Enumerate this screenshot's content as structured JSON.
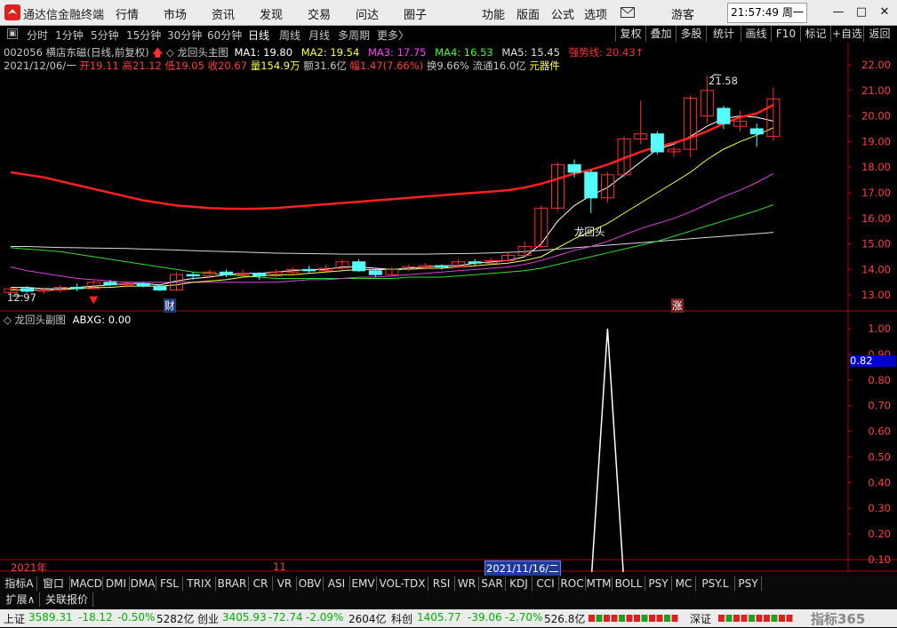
{
  "app": {
    "title": "通达信金融终端",
    "user": "游客",
    "clock": "21:57:49 周一"
  },
  "menu": [
    "行情",
    "市场",
    "资讯",
    "发现",
    "交易",
    "问达",
    "圈子"
  ],
  "menu_right": [
    "功能",
    "版面",
    "公式",
    "选项"
  ],
  "periods": [
    "分时",
    "1分钟",
    "5分钟",
    "15分钟",
    "30分钟",
    "60分钟",
    "日线",
    "周线",
    "月线",
    "多周期",
    "更多〉"
  ],
  "active_period": "日线",
  "right_buttons": [
    "复权",
    "叠加",
    "多股",
    "统计",
    "画线",
    "F10",
    "标记",
    "+自选",
    "返回"
  ],
  "stock": {
    "header": "002056 横店东磁(日线,前复权)",
    "indicator": "龙回头主图"
  },
  "ma_labels": [
    {
      "text": "MA1: 19.80",
      "color": "#ffffff"
    },
    {
      "text": "MA2: 19.54",
      "color": "#ffff40"
    },
    {
      "text": "MA3: 17.75",
      "color": "#ff40ff"
    },
    {
      "text": "MA4: 16.53",
      "color": "#40ff40"
    },
    {
      "text": "MA5: 15.45",
      "color": "#e0e0e0"
    },
    {
      "text": "强势线: 20.43",
      "color": "#ff3030"
    }
  ],
  "quote": {
    "date": "2021/12/06/一",
    "open": "开19.11",
    "high": "高21.12",
    "low": "低19.05",
    "close": "收20.67",
    "vol": "量154.9万",
    "amount": "额31.6亿",
    "change": "幅1.47(7.66%)",
    "turnover": "换9.66%",
    "float": "流通16.0亿",
    "sector": "元器件"
  },
  "annotations": {
    "high_label": "21.58",
    "low_label": "12.97",
    "signal_label": "龙回头",
    "cai_mark": "财",
    "zhang_mark": "涨"
  },
  "sub_indicator": {
    "title": "龙回头副图",
    "value_label": "ABXG: 0.00",
    "marker": "0.82"
  },
  "x_axis": {
    "year": "2021年",
    "month": "11",
    "cursor": "2021/11/16/二"
  },
  "indicator_tabs": [
    "指标A",
    "窗口",
    "MACD",
    "DMI",
    "DMA",
    "FSL",
    "TRIX",
    "BRAR",
    "CR",
    "VR",
    "OBV",
    "ASI",
    "EMV",
    "VOL-TDX",
    "RSI",
    "WR",
    "SAR",
    "KDJ",
    "CCI",
    "ROC",
    "MTM",
    "BOLL",
    "PSY",
    "MC",
    "PSY.L",
    "PSY"
  ],
  "ext_tabs": [
    "扩展∧",
    "关联报价"
  ],
  "status": {
    "sh_label": "上证",
    "sh_val": "3589.31",
    "sh_chg": "-18.12",
    "sh_pct": "-0.50%",
    "sh_amt": "5282亿",
    "cy_label": "创业",
    "cy_val": "3405.93",
    "cy_chg": "-72.74",
    "cy_pct": "-2.09%",
    "cy_amt": "2604亿",
    "kc_label": "科创",
    "kc_val": "1405.77",
    "kc_chg": "-39.06",
    "kc_pct": "-2.70%",
    "kc_amt": "526.8亿",
    "sz_label": "深证",
    "watermark": "指标365"
  },
  "chart_data": {
    "type": "candlestick",
    "main_yticks": [
      22.0,
      21.0,
      20.0,
      19.0,
      18.0,
      17.0,
      16.0,
      15.0,
      14.0,
      13.0
    ],
    "sub_yticks": [
      1.0,
      0.9,
      0.8,
      0.7,
      0.6,
      0.5,
      0.4,
      0.3,
      0.2,
      0.1
    ],
    "candles": [
      [
        13.1,
        13.25,
        13.0,
        13.3
      ],
      [
        13.25,
        13.15,
        13.1,
        13.35
      ],
      [
        13.15,
        13.2,
        13.05,
        13.3
      ],
      [
        13.2,
        13.3,
        13.1,
        13.4
      ],
      [
        13.3,
        13.25,
        13.15,
        13.45
      ],
      [
        13.25,
        13.5,
        13.2,
        13.6
      ],
      [
        13.5,
        13.4,
        13.35,
        13.6
      ],
      [
        13.4,
        13.45,
        13.3,
        13.55
      ],
      [
        13.45,
        13.35,
        13.3,
        13.5
      ],
      [
        13.35,
        13.2,
        13.15,
        13.4
      ],
      [
        13.2,
        13.8,
        13.15,
        13.9
      ],
      [
        13.8,
        13.75,
        13.6,
        13.9
      ],
      [
        13.75,
        13.9,
        13.7,
        14.0
      ],
      [
        13.9,
        13.8,
        13.7,
        14.0
      ],
      [
        13.8,
        13.85,
        13.7,
        14.0
      ],
      [
        13.85,
        13.75,
        13.6,
        13.9
      ],
      [
        13.75,
        13.9,
        13.7,
        14.0
      ],
      [
        13.9,
        14.0,
        13.8,
        14.1
      ],
      [
        14.0,
        13.95,
        13.85,
        14.15
      ],
      [
        13.95,
        14.05,
        13.9,
        14.2
      ],
      [
        14.05,
        14.3,
        14.0,
        14.4
      ],
      [
        14.3,
        13.95,
        13.9,
        14.4
      ],
      [
        13.95,
        13.8,
        13.7,
        14.0
      ],
      [
        13.8,
        14.0,
        13.75,
        14.1
      ],
      [
        14.0,
        14.1,
        13.95,
        14.2
      ],
      [
        14.1,
        14.15,
        14.0,
        14.25
      ],
      [
        14.15,
        14.1,
        14.0,
        14.2
      ],
      [
        14.1,
        14.3,
        14.05,
        14.4
      ],
      [
        14.3,
        14.25,
        14.15,
        14.4
      ],
      [
        14.25,
        14.35,
        14.2,
        14.45
      ],
      [
        14.35,
        14.55,
        14.3,
        14.7
      ],
      [
        14.55,
        14.9,
        14.5,
        15.1
      ],
      [
        14.9,
        16.4,
        14.85,
        16.5
      ],
      [
        16.4,
        18.1,
        16.3,
        18.2
      ],
      [
        18.1,
        17.8,
        17.6,
        18.3
      ],
      [
        17.8,
        16.8,
        16.2,
        17.9
      ],
      [
        16.8,
        17.7,
        16.6,
        17.8
      ],
      [
        17.7,
        19.1,
        17.6,
        19.2
      ],
      [
        19.1,
        19.3,
        18.9,
        20.6
      ],
      [
        19.3,
        18.6,
        18.5,
        19.4
      ],
      [
        18.6,
        18.7,
        18.4,
        18.8
      ],
      [
        18.7,
        20.7,
        18.4,
        20.8
      ],
      [
        20.0,
        21.0,
        19.7,
        21.58
      ],
      [
        20.3,
        19.7,
        19.5,
        20.4
      ],
      [
        19.6,
        19.8,
        19.4,
        20.2
      ],
      [
        19.5,
        19.3,
        18.8,
        19.7
      ],
      [
        19.2,
        20.67,
        19.05,
        21.12
      ]
    ],
    "strong_line": [
      17.8,
      17.7,
      17.6,
      17.45,
      17.3,
      17.15,
      17.0,
      16.85,
      16.7,
      16.6,
      16.5,
      16.45,
      16.4,
      16.38,
      16.37,
      16.38,
      16.4,
      16.45,
      16.5,
      16.55,
      16.6,
      16.65,
      16.7,
      16.75,
      16.8,
      16.85,
      16.9,
      16.95,
      17.0,
      17.05,
      17.1,
      17.2,
      17.35,
      17.55,
      17.75,
      17.9,
      18.1,
      18.35,
      18.6,
      18.8,
      18.95,
      19.15,
      19.4,
      19.7,
      19.95,
      20.1,
      20.43
    ],
    "ma1": [
      13.3,
      13.3,
      13.25,
      13.25,
      13.3,
      13.35,
      13.4,
      13.45,
      13.45,
      13.4,
      13.55,
      13.65,
      13.7,
      13.8,
      13.85,
      13.85,
      13.9,
      13.95,
      14.0,
      14.0,
      14.1,
      14.1,
      14.05,
      14.0,
      14.05,
      14.1,
      14.15,
      14.15,
      14.25,
      14.3,
      14.35,
      14.5,
      15.0,
      15.9,
      16.5,
      16.9,
      17.2,
      17.7,
      18.2,
      18.7,
      18.9,
      19.2,
      19.6,
      19.9,
      20.0,
      19.95,
      19.8
    ],
    "ma2": [
      13.2,
      13.2,
      13.2,
      13.2,
      13.25,
      13.3,
      13.3,
      13.35,
      13.35,
      13.35,
      13.4,
      13.5,
      13.55,
      13.6,
      13.7,
      13.75,
      13.8,
      13.8,
      13.85,
      13.9,
      13.95,
      14.0,
      14.0,
      14.0,
      14.0,
      14.05,
      14.05,
      14.1,
      14.15,
      14.2,
      14.25,
      14.35,
      14.5,
      14.85,
      15.2,
      15.5,
      15.8,
      16.2,
      16.6,
      17.0,
      17.4,
      17.8,
      18.3,
      18.7,
      19.0,
      19.25,
      19.54
    ],
    "ma3": [
      14.1,
      13.95,
      13.85,
      13.75,
      13.65,
      13.6,
      13.55,
      13.5,
      13.5,
      13.5,
      13.5,
      13.5,
      13.5,
      13.5,
      13.5,
      13.5,
      13.5,
      13.55,
      13.6,
      13.6,
      13.65,
      13.7,
      13.7,
      13.75,
      13.8,
      13.85,
      13.9,
      13.95,
      14.0,
      14.05,
      14.1,
      14.2,
      14.35,
      14.55,
      14.75,
      14.9,
      15.1,
      15.35,
      15.6,
      15.8,
      16.0,
      16.25,
      16.55,
      16.85,
      17.1,
      17.4,
      17.75
    ],
    "ma4": [
      14.85,
      14.8,
      14.75,
      14.7,
      14.6,
      14.5,
      14.4,
      14.3,
      14.2,
      14.1,
      14.0,
      13.9,
      13.85,
      13.8,
      13.75,
      13.7,
      13.65,
      13.65,
      13.65,
      13.65,
      13.65,
      13.65,
      13.65,
      13.65,
      13.7,
      13.7,
      13.7,
      13.75,
      13.8,
      13.85,
      13.9,
      13.95,
      14.05,
      14.2,
      14.35,
      14.5,
      14.65,
      14.8,
      14.95,
      15.1,
      15.3,
      15.5,
      15.7,
      15.9,
      16.1,
      16.3,
      16.53
    ],
    "ma5": [
      14.9,
      14.9,
      14.88,
      14.86,
      14.85,
      14.84,
      14.83,
      14.82,
      14.8,
      14.78,
      14.76,
      14.74,
      14.72,
      14.7,
      14.68,
      14.66,
      14.64,
      14.63,
      14.62,
      14.61,
      14.6,
      14.6,
      14.6,
      14.6,
      14.6,
      14.6,
      14.61,
      14.62,
      14.63,
      14.65,
      14.67,
      14.7,
      14.75,
      14.8,
      14.85,
      14.9,
      14.95,
      15.0,
      15.05,
      15.1,
      15.15,
      15.2,
      15.25,
      15.3,
      15.35,
      15.4,
      15.45
    ],
    "abxg_spike_index": 36,
    "abxg_spike_value": 1.0
  }
}
